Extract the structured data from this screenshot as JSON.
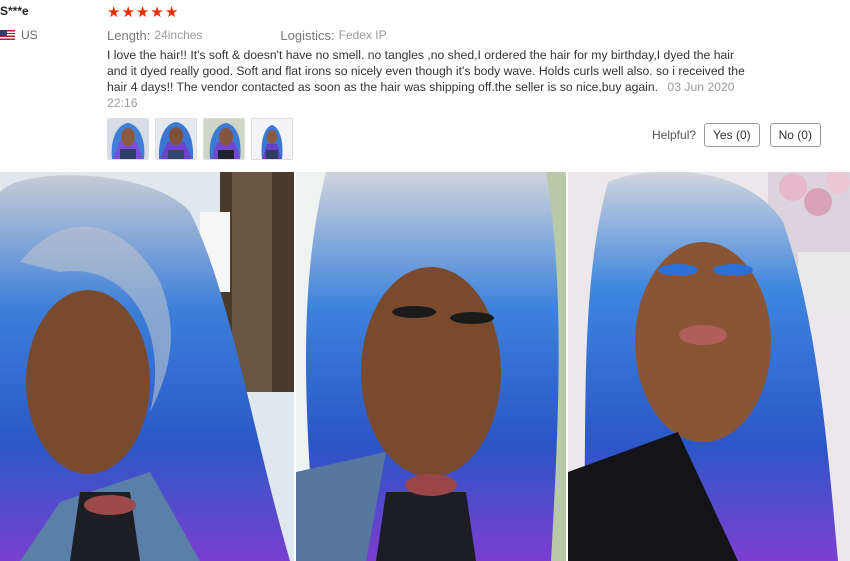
{
  "review": {
    "reviewer_name": "S***e",
    "country": "US",
    "rating": 5,
    "length_label": "Length:",
    "length_value": "24inches",
    "logistics_label": "Logistics:",
    "logistics_value": "Fedex IP",
    "text": "I love the hair!! It's soft & doesn't have no smell. no tangles ,no shed,I ordered the hair for my birthday,I dyed the hair and it dyed really good. Soft and flat irons so nicely even though it's body wave. Holds curls well also. so i received the hair 4 days!! The vendor contacted as soon as the hair was shipping off.the seller is so nice,buy again.",
    "date": "03 Jun 2020 22:16",
    "thumbnail_count": 4
  },
  "helpful": {
    "label": "Helpful?",
    "yes_label": "Yes (0)",
    "no_label": "No (0)"
  },
  "colors": {
    "star": "#e62e04",
    "hair_blue": "#2f6fd0",
    "hair_purple": "#6a3fc8",
    "hair_silver": "#c9cdd6"
  }
}
